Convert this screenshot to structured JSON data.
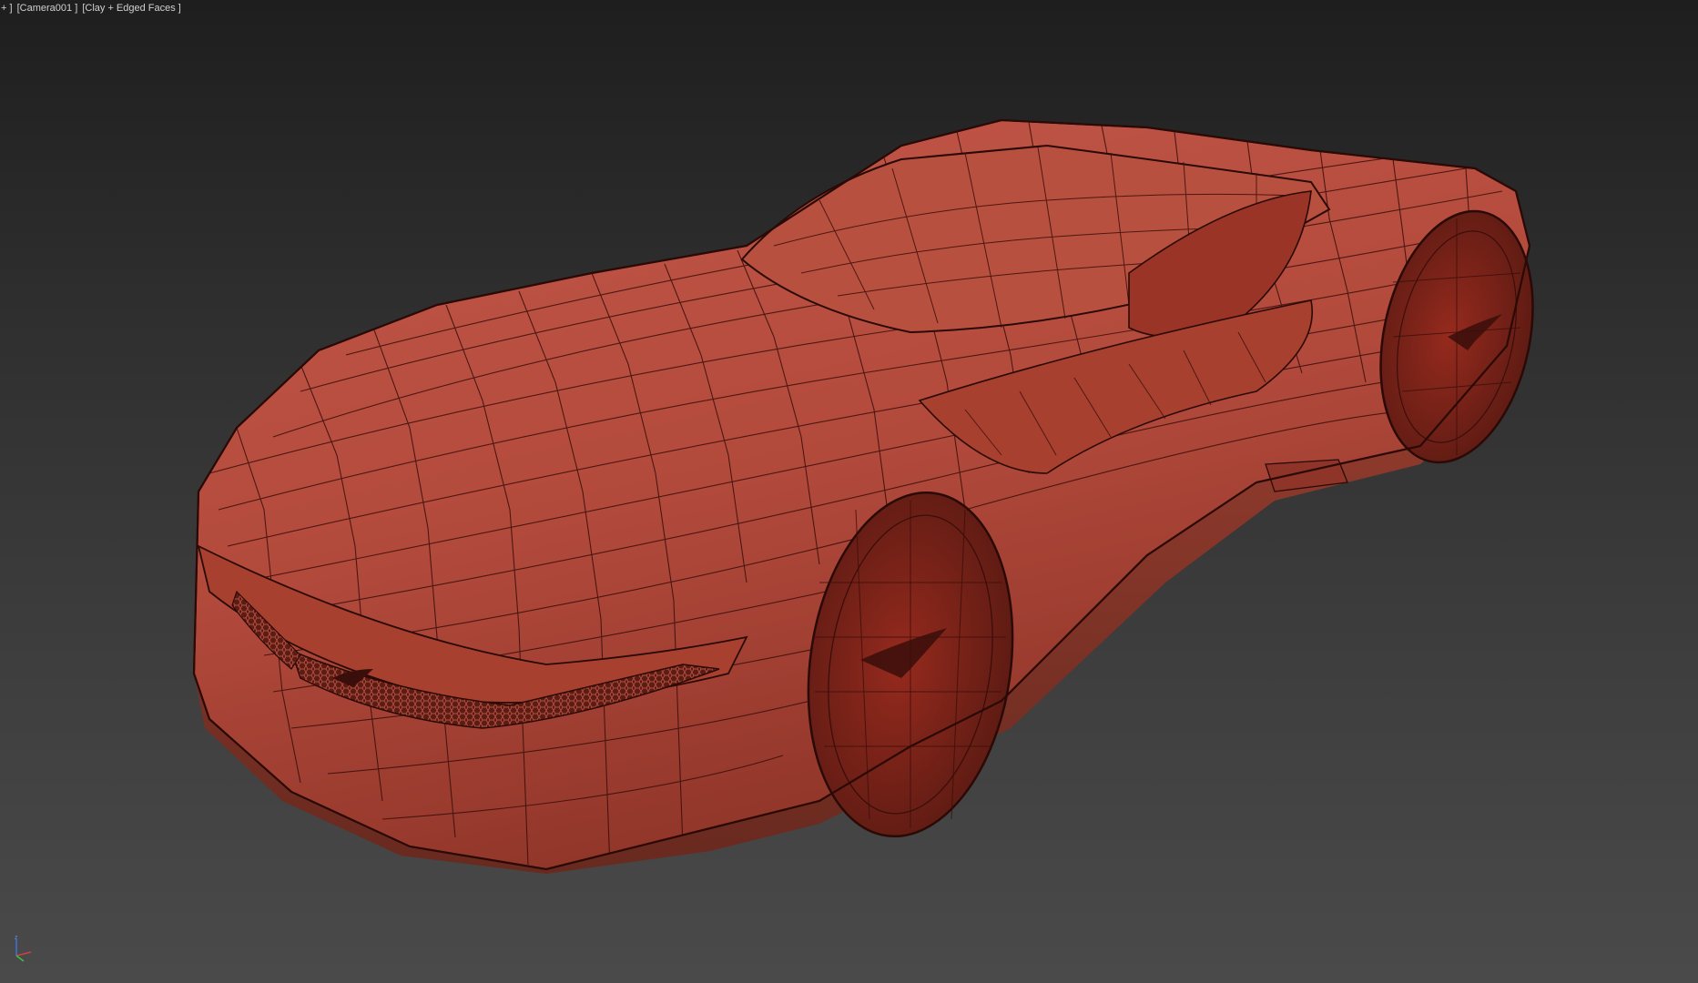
{
  "viewport": {
    "menu_label": "+ ]",
    "camera_label": "[Camera001 ]",
    "shading_label": "[Clay + Edged Faces ]"
  },
  "scene": {
    "object": "car-body-mesh",
    "material_color": "#b24a3c",
    "wire_color": "#3a0e0a",
    "background_top": "#1e1e1e",
    "background_bottom": "#4a4a4a"
  },
  "gizmo": {
    "axis_z": "z",
    "colors": {
      "x": "#d04040",
      "y": "#40c040",
      "z": "#4070e0"
    }
  }
}
